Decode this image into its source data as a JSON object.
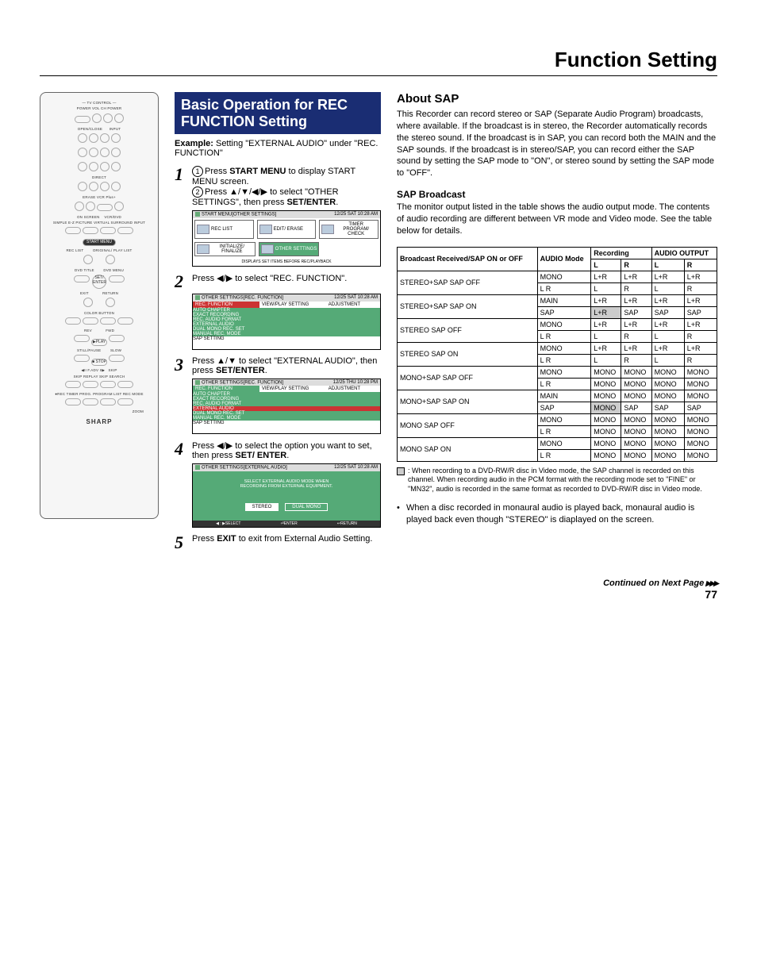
{
  "page_title": "Function Setting",
  "remote": {
    "tv_control": "— TV CONTROL —",
    "power": "POWER",
    "vol": "VOL",
    "ch": "CH",
    "open_close": "OPEN/CLOSE",
    "input": "INPUT",
    "direct": "DIRECT",
    "erase": "ERASE",
    "vcr_plus": "VCR Plus+",
    "on_screen": "ON SCREEN",
    "vcr_dvd": "VCR/DVD",
    "simple": "SIMPLE",
    "ez_picture": "E-Z PICTURE",
    "virtual": "VIRTUAL SURROUND",
    "start_menu": "START MENU",
    "rec_list": "REC LIST",
    "original_playlist": "ORIGINAL/ PLAY LIST",
    "dvd_title": "DVD TITLE",
    "dvd_menu": "DVD MENU",
    "set_enter": "SET/ ENTER",
    "exit": "EXIT",
    "return": "RETURN",
    "color_button": "COLOR BUTTON",
    "rev": "REV",
    "fwd": "FWD",
    "play": "▶PLAY",
    "still_pause": "STILL/PAUSE",
    "slow": "SLOW",
    "stop": "■ STOP",
    "fadv": "◀II F.ADV II▶",
    "skip": "SKIP",
    "replay": "REPLAY",
    "search": "SKIP SEARCH",
    "rec": "●REC",
    "timer": "TIMER PROG.",
    "program": "PROGRAM LIST",
    "rec_mode": "REC MODE",
    "zoom": "ZOOM",
    "logo": "SHARP"
  },
  "section_head": "Basic Operation for REC FUNCTION Setting",
  "example_label": "Example:",
  "example_text": " Setting \"EXTERNAL AUDIO\" under \"REC. FUNCTION\"",
  "step1": {
    "line1_a": "Press ",
    "line1_b": "START MENU",
    "line1_c": " to display START MENU screen.",
    "line2_a": "Press ▲/▼/◀/▶ to select \"OTHER SETTINGS\", then press ",
    "line2_b": "SET/ENTER",
    "line2_c": "."
  },
  "osd1": {
    "title": "START MENU[OTHER SETTINGS]",
    "time": "12/25  SAT 10:28  AM",
    "b1": "REC LIST",
    "b2": "EDIT/ ERASE",
    "b3": "TIMER PROGRAM/ CHECK",
    "b4": "INITIALIZE/ FINALIZE",
    "b5": "OTHER SETTINGS",
    "foot": "DISPLAYS SET ITEMS BEFORE REC/PLAYBACK"
  },
  "step2": "Press ◀/▶  to select \"REC. FUNCTION\".",
  "osd2": {
    "title": "OTHER SETTINGS[REC. FUNCTION]",
    "time": "12/25  SAT 10:28  AM",
    "tabs": [
      "REC. FUNCTION",
      "VIEW/PLAY SETTING",
      "ADJUSTMENT"
    ],
    "items": [
      "AUTO CHAPTER",
      "EXACT RECORDING",
      "REC. AUDIO FORMAT",
      "EXTERNAL AUDIO",
      "DUAL MONO REC. SET",
      "MANUAL REC. MODE",
      "SAP SETTING"
    ]
  },
  "step3_a": "Press ▲/▼ to select \"EXTERNAL AUDIO\", then press ",
  "step3_b": "SET/ENTER",
  "step3_c": ".",
  "osd3": {
    "title": "OTHER SETTINGS[REC. FUNCTION]",
    "time": "12/25  THU 10:28  PM",
    "tabs": [
      "REC. FUNCTION",
      "VIEW/PLAY SETTING",
      "ADJUSTMENT"
    ],
    "items": [
      "AUTO CHAPTER",
      "EXACT RECORDING",
      "REC. AUDIO FORMAT",
      "EXTERNAL AUDIO",
      "DUAL MONO REC. SET",
      "MANUAL REC. MODE",
      "SAP SETTING"
    ]
  },
  "step4_a": "Press ◀/▶ to select the option you want to set, then press ",
  "step4_b": "SET/ ENTER",
  "step4_c": ".",
  "osd4": {
    "title": "OTHER SETTINGS[EXTERNAL AUDIO]",
    "time": "12/25  SAT 10:28  AM",
    "msg1": "SELECT EXTERNAL AUDIO MODE WHEN",
    "msg2": "RECORDING FROM EXTERNAL EQUIPMENT.",
    "opt1": "STEREO",
    "opt2": "DUAL MONO",
    "f1": "◀ : ▶SELECT",
    "f2": "⏎ENTER",
    "f3": "↩RETURN"
  },
  "step5_a": "Press ",
  "step5_b": "EXIT",
  "step5_c": " to exit from External Audio Setting.",
  "about_sap_head": "About SAP",
  "about_sap_body": "This Recorder can record stereo or SAP (Separate Audio Program) broadcasts, where available. If the broadcast is in stereo, the Recorder automatically records the stereo sound. If the broadcast is in SAP, you can record both the MAIN and the SAP sounds. If the broadcast is in stereo/SAP, you can record either the SAP sound by setting the SAP mode to \"ON\", or stereo sound by setting the SAP mode to \"OFF\".",
  "sap_sub": "SAP Broadcast",
  "sap_sub_body": "The monitor output listed in the table shows the audio output mode. The contents of audio recording are different between VR mode and Video mode. See the table below for details.",
  "table": {
    "h_broadcast": "Broadcast Received/SAP ON or OFF",
    "h_audio_mode": "AUDIO Mode",
    "h_recording": "Recording",
    "h_audio_out": "AUDIO OUTPUT",
    "h_l": "L",
    "h_r": "R",
    "rows": [
      {
        "b": "STEREO+SAP SAP OFF",
        "m1": "MONO",
        "r1l": "L+R",
        "r1r": "L+R",
        "o1l": "L+R",
        "o1r": "L+R",
        "m2": "L R",
        "r2l": "L",
        "r2r": "R",
        "o2l": "L",
        "o2r": "R"
      },
      {
        "b": "STEREO+SAP SAP ON",
        "m1": "MAIN",
        "r1l": "L+R",
        "r1r": "L+R",
        "o1l": "L+R",
        "o1r": "L+R",
        "m2": "SAP",
        "r2l": "L+R",
        "r2r": "SAP",
        "o2l": "SAP",
        "o2r": "SAP",
        "hl2l": true
      },
      {
        "b": "STEREO SAP OFF",
        "m1": "MONO",
        "r1l": "L+R",
        "r1r": "L+R",
        "o1l": "L+R",
        "o1r": "L+R",
        "m2": "L R",
        "r2l": "L",
        "r2r": "R",
        "o2l": "L",
        "o2r": "R"
      },
      {
        "b": "STEREO SAP ON",
        "m1": "MONO",
        "r1l": "L+R",
        "r1r": "L+R",
        "o1l": "L+R",
        "o1r": "L+R",
        "m2": "L R",
        "r2l": "L",
        "r2r": "R",
        "o2l": "L",
        "o2r": "R"
      },
      {
        "b": "MONO+SAP SAP OFF",
        "m1": "MONO",
        "r1l": "MONO",
        "r1r": "MONO",
        "o1l": "MONO",
        "o1r": "MONO",
        "m2": "L R",
        "r2l": "MONO",
        "r2r": "MONO",
        "o2l": "MONO",
        "o2r": "MONO"
      },
      {
        "b": "MONO+SAP SAP ON",
        "m1": "MAIN",
        "r1l": "MONO",
        "r1r": "MONO",
        "o1l": "MONO",
        "o1r": "MONO",
        "m2": "SAP",
        "r2l": "MONO",
        "r2r": "SAP",
        "o2l": "SAP",
        "o2r": "SAP",
        "hl2l": true
      },
      {
        "b": "MONO SAP OFF",
        "m1": "MONO",
        "r1l": "MONO",
        "r1r": "MONO",
        "o1l": "MONO",
        "o1r": "MONO",
        "m2": "L R",
        "r2l": "MONO",
        "r2r": "MONO",
        "o2l": "MONO",
        "o2r": "MONO"
      },
      {
        "b": "MONO SAP ON",
        "m1": "MONO",
        "r1l": "MONO",
        "r1r": "MONO",
        "o1l": "MONO",
        "o1r": "MONO",
        "m2": "L R",
        "r2l": "MONO",
        "r2r": "MONO",
        "o2l": "MONO",
        "o2r": "MONO"
      }
    ]
  },
  "note": ": When recording to a DVD-RW/R disc in Video mode, the SAP channel is recorded on this channel. When recording audio in the PCM format with the recording mode set to \"FINE\" or \"MN32\", audio is recorded in the same format as recorded to DVD-RW/R disc in Video mode.",
  "bullet": "When a disc recorded in monaural audio is played back, monaural audio is played back even though \"STEREO\" is diaplayed on the screen.",
  "continued": "Continued on Next Page",
  "page_num": "77"
}
